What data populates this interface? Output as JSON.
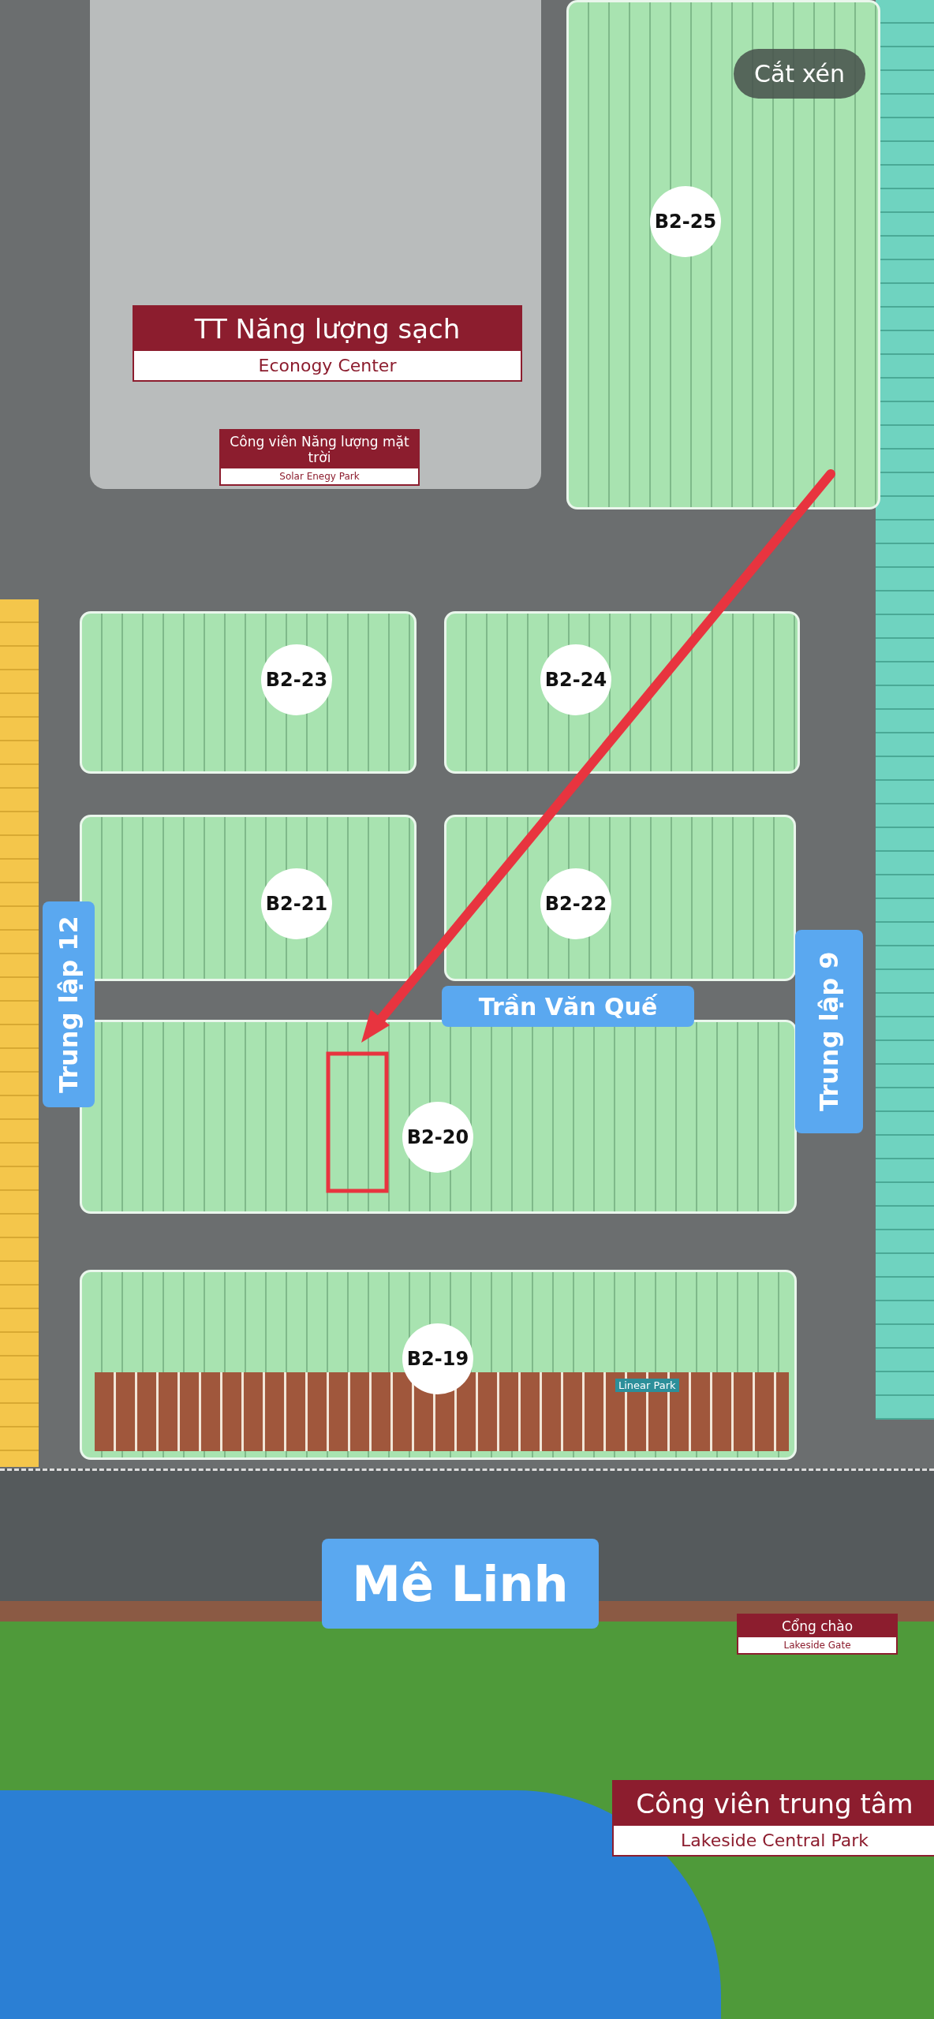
{
  "viewer": {
    "crop_button": "Cắt xén"
  },
  "map": {
    "facilities": [
      {
        "title": "TT Năng lượng sạch",
        "subtitle": "Econogy Center"
      },
      {
        "title": "Công viên Năng lượng mặt trời",
        "subtitle": "Solar Enegy Park"
      },
      {
        "title": "Cổng chào",
        "subtitle": "Lakeside Gate"
      },
      {
        "title": "Công viên trung tâm",
        "subtitle": "Lakeside Central Park"
      }
    ],
    "blocks": [
      "B2-25",
      "B2-23",
      "B2-24",
      "B2-21",
      "B2-22",
      "B2-20",
      "B2-19"
    ],
    "street_labels": [
      {
        "text": "Trần Văn Quế",
        "kind": "horizontal"
      },
      {
        "text": "Trung lập 12",
        "kind": "vertical"
      },
      {
        "text": "Trung lập 9",
        "kind": "vertical"
      },
      {
        "text": "Mê Linh",
        "kind": "large"
      }
    ],
    "park_label": "Linear Park"
  }
}
